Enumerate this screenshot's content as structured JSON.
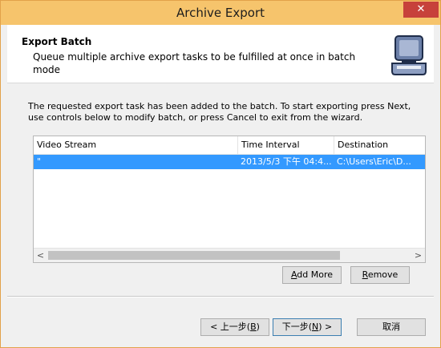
{
  "window": {
    "title": "Archive Export",
    "close_glyph": "✕"
  },
  "header": {
    "title": "Export Batch",
    "description": "Queue multiple archive export tasks to be fulfilled at once in batch mode",
    "icon": "laptop-case-icon"
  },
  "content": {
    "intro": "The requested export task has been added to the batch. To start exporting press Next, use controls below to modify batch, or press Cancel to exit from the wizard."
  },
  "list": {
    "columns": [
      "Video Stream",
      "Time Interval",
      "Destination"
    ],
    "rows": [
      {
        "stream": "\"",
        "interval": "2013/5/3 下午 04:4...",
        "destination": "C:\\Users\\Eric\\D..."
      }
    ],
    "scroll_left": "<",
    "scroll_right": ">"
  },
  "buttons": {
    "add_more": {
      "pre": "",
      "accel": "A",
      "post": "dd More"
    },
    "remove": {
      "pre": "",
      "accel": "R",
      "post": "emove"
    },
    "back": {
      "pre": "< 上一步(",
      "accel": "B",
      "post": ")"
    },
    "next": {
      "pre": "下一步(",
      "accel": "N",
      "post": ") >"
    },
    "cancel": "取消"
  },
  "colors": {
    "titlebar": "#f6c46c",
    "selection": "#3399ff",
    "close": "#c7413b"
  }
}
